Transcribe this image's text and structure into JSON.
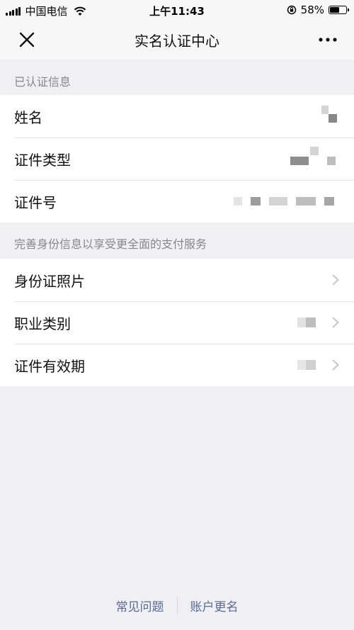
{
  "status_bar": {
    "carrier": "中国电信",
    "time": "上午11:43",
    "battery": "58%",
    "battery_level": 0.58
  },
  "nav": {
    "title": "实名认证中心",
    "close_icon": "close-icon",
    "more_icon": "more-icon"
  },
  "sections": {
    "verified_header": "已认证信息",
    "verified_rows": {
      "name": "姓名",
      "id_type": "证件类型",
      "id_number": "证件号"
    },
    "complete_header": "完善身份信息以享受更全面的支付服务",
    "complete_rows": {
      "id_photo": "身份证照片",
      "occupation": "职业类别",
      "validity": "证件有效期"
    }
  },
  "footer": {
    "faq": "常见问题",
    "rename": "账户更名"
  },
  "colors": {
    "background": "#efeff4",
    "bar": "#f7f7f7",
    "link": "#576b95",
    "secondary_text": "#888888"
  }
}
